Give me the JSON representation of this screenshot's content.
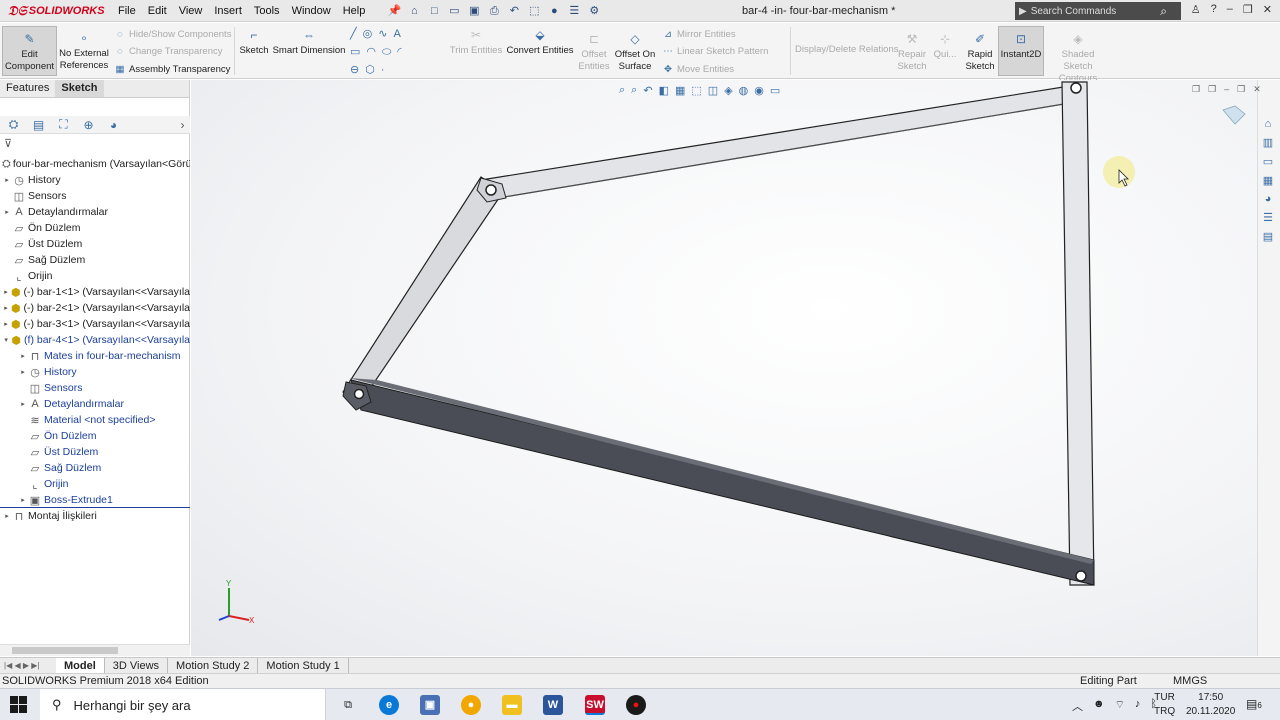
{
  "app": {
    "logo_text": "SOLIDWORKS",
    "doc_title": "bar-4 -in- four-bar-mechanism *",
    "menus": [
      "File",
      "Edit",
      "View",
      "Insert",
      "Tools",
      "Window",
      "Help"
    ],
    "search_placeholder": "Search Commands"
  },
  "cmd": {
    "edit_component": "Edit Component",
    "no_external": "No External References",
    "hide_show": "Hide/Show Components",
    "change_transparency": "Change Transparency",
    "assembly_transparency": "Assembly Transparency",
    "sketch": "Sketch",
    "smart_dimension": "Smart Dimension",
    "trim_entities": "Trim Entities",
    "convert_entities": "Convert Entities",
    "offset_entities": "Offset Entities",
    "offset_on_surface": "Offset On Surface",
    "mirror_entities": "Mirror Entities",
    "linear_sketch_pattern": "Linear Sketch Pattern",
    "move_entities": "Move Entities",
    "display_delete_relations": "Display/Delete Relations",
    "repair_sketch": "Repair Sketch",
    "quick_snaps": "Qui...",
    "rapid_sketch": "Rapid Sketch",
    "instant2d": "Instant2D",
    "shaded_sketch_contours": "Shaded Sketch Contours"
  },
  "panel": {
    "tabs": [
      "Features",
      "Sketch"
    ],
    "active_tab": "Sketch",
    "tree": [
      {
        "label": "four-bar-mechanism  (Varsayılan<Görü",
        "level": 0,
        "expand": "",
        "icon": "assembly-icon",
        "blue": false
      },
      {
        "label": "History",
        "level": 0,
        "expand": "▸",
        "icon": "history-icon",
        "blue": false
      },
      {
        "label": "Sensors",
        "level": 0,
        "expand": "",
        "icon": "sensor-icon",
        "blue": false
      },
      {
        "label": "Detaylandırmalar",
        "level": 0,
        "expand": "▸",
        "icon": "annotation-icon",
        "blue": false
      },
      {
        "label": "Ön Düzlem",
        "level": 0,
        "expand": "",
        "icon": "plane-icon",
        "blue": false
      },
      {
        "label": "Üst Düzlem",
        "level": 0,
        "expand": "",
        "icon": "plane-icon",
        "blue": false
      },
      {
        "label": "Sağ Düzlem",
        "level": 0,
        "expand": "",
        "icon": "plane-icon",
        "blue": false
      },
      {
        "label": "Orijin",
        "level": 0,
        "expand": "",
        "icon": "origin-icon",
        "blue": false
      },
      {
        "label": "(-) bar-1<1> (Varsayılan<<Varsayıla",
        "level": 0,
        "expand": "▸",
        "icon": "part-icon",
        "blue": false
      },
      {
        "label": "(-) bar-2<1> (Varsayılan<<Varsayıla",
        "level": 0,
        "expand": "▸",
        "icon": "part-icon",
        "blue": false
      },
      {
        "label": "(-) bar-3<1> (Varsayılan<<Varsayıla",
        "level": 0,
        "expand": "▸",
        "icon": "part-icon",
        "blue": false
      },
      {
        "label": "(f) bar-4<1> (Varsayılan<<Varsayıla",
        "level": 0,
        "expand": "▾",
        "icon": "part-icon",
        "blue": true
      },
      {
        "label": "Mates in four-bar-mechanism",
        "level": 1,
        "expand": "▸",
        "icon": "mates-icon",
        "blue": true
      },
      {
        "label": "History",
        "level": 1,
        "expand": "▸",
        "icon": "history-icon",
        "blue": true
      },
      {
        "label": "Sensors",
        "level": 1,
        "expand": "",
        "icon": "sensor-icon",
        "blue": true
      },
      {
        "label": "Detaylandırmalar",
        "level": 1,
        "expand": "▸",
        "icon": "annotation-icon",
        "blue": true
      },
      {
        "label": "Material <not specified>",
        "level": 1,
        "expand": "",
        "icon": "material-icon",
        "blue": true
      },
      {
        "label": "Ön Düzlem",
        "level": 1,
        "expand": "",
        "icon": "plane-icon",
        "blue": true
      },
      {
        "label": "Üst Düzlem",
        "level": 1,
        "expand": "",
        "icon": "plane-icon",
        "blue": true
      },
      {
        "label": "Sağ Düzlem",
        "level": 1,
        "expand": "",
        "icon": "plane-icon",
        "blue": true
      },
      {
        "label": "Orijin",
        "level": 1,
        "expand": "",
        "icon": "origin-icon",
        "blue": true
      },
      {
        "label": "Boss-Extrude1",
        "level": 1,
        "expand": "▸",
        "icon": "extrude-icon",
        "blue": true
      },
      {
        "label": "Montaj İlişkileri",
        "level": 0,
        "expand": "▸",
        "icon": "mates-icon",
        "blue": false
      }
    ]
  },
  "viewport": {
    "axis_y": "Y",
    "axis_x": "X"
  },
  "bottom_tabs": [
    "Model",
    "3D Views",
    "Motion Study 2",
    "Motion Study 1"
  ],
  "active_bottom_tab": "Model",
  "status": {
    "left": "SOLIDWORKS Premium 2018 x64 Edition",
    "mode": "Editing Part",
    "units": "MMGS"
  },
  "taskbar": {
    "search_placeholder": "Herhangi bir şey ara",
    "lang_1": "TUR",
    "lang_2": "TRQ",
    "time": "17:50",
    "date": "20.11.2020",
    "notifications": "6",
    "colors": {
      "edge": "#0a78d7",
      "chrome": "#f2a600",
      "word": "#2b579a",
      "solidworks": "#c8102e",
      "record": "#1a1a1a",
      "folder": "#f0c020",
      "store": "#4a6fb5"
    }
  }
}
